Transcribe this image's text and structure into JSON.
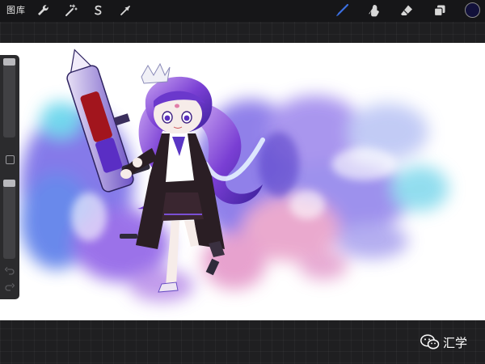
{
  "toolbar": {
    "gallery_label": "图库",
    "actions_icon": "wrench-icon",
    "adjustments_icon": "magic-wand-icon",
    "selection_icon": "selection-s-icon",
    "transform_icon": "arrow-cursor-icon",
    "brush_icon": "brush-icon",
    "smudge_icon": "smudge-finger-icon",
    "eraser_icon": "eraser-icon",
    "layers_icon": "layers-icon",
    "current_color": "#12113a",
    "active_tool_color": "#3b6fe0"
  },
  "sidebar": {
    "brush_size_level": 0.0,
    "opacity_level": 0.0,
    "modify_icon": "square-modify-icon",
    "undo_icon": "undo-icon",
    "redo_icon": "redo-icon"
  },
  "canvas": {
    "background": "#ffffff",
    "artwork": "watercolor-character-illustration"
  },
  "watermark": {
    "icon": "wechat-icon",
    "text": "汇学"
  }
}
